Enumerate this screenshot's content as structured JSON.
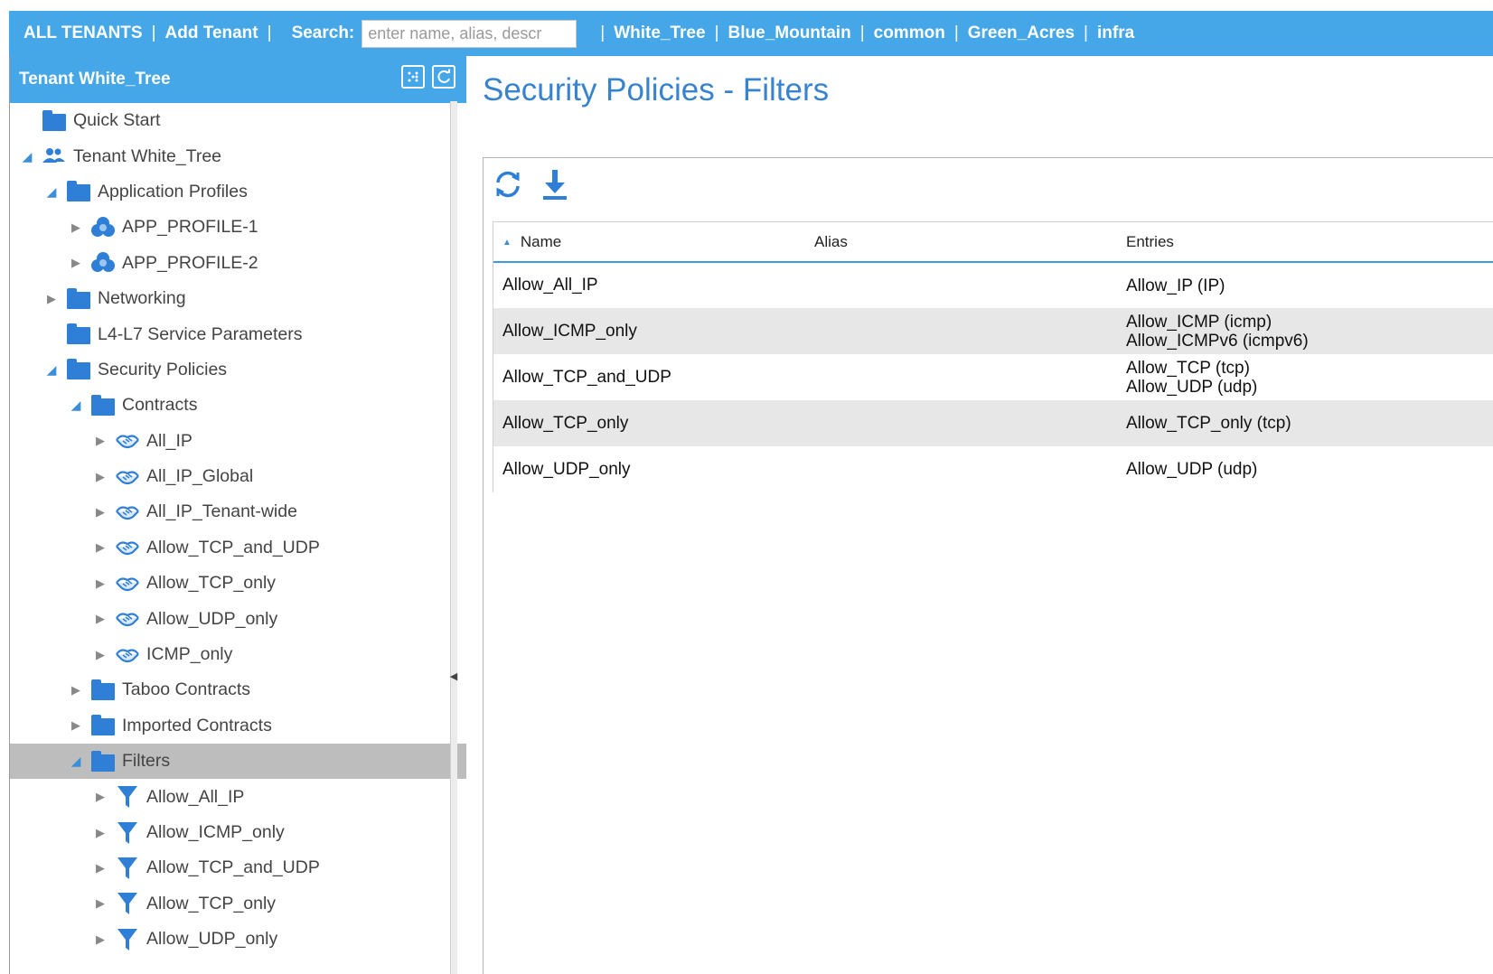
{
  "topbar": {
    "all_tenants": "ALL TENANTS",
    "add_tenant": "Add Tenant",
    "search_label": "Search:",
    "search_placeholder": "enter name, alias, descr",
    "search_value": "",
    "tenants": [
      "White_Tree",
      "Blue_Mountain",
      "common",
      "Green_Acres",
      "infra"
    ],
    "background_color": "#45a7e7"
  },
  "sidebar": {
    "title": "Tenant White_Tree",
    "header_icons": [
      "layout-icon",
      "refresh-icon"
    ],
    "items": [
      {
        "label": "Quick Start",
        "icon": "folder-icon",
        "level": 0,
        "caret": "none"
      },
      {
        "label": "Tenant White_Tree",
        "icon": "tenant-users-icon",
        "level": 0,
        "caret": "expanded"
      },
      {
        "label": "Application Profiles",
        "icon": "folder-icon",
        "level": 1,
        "caret": "expanded"
      },
      {
        "label": "APP_PROFILE-1",
        "icon": "app-profile-icon",
        "level": 2,
        "caret": "collapsed"
      },
      {
        "label": "APP_PROFILE-2",
        "icon": "app-profile-icon",
        "level": 2,
        "caret": "collapsed"
      },
      {
        "label": "Networking",
        "icon": "folder-icon",
        "level": 1,
        "caret": "collapsed"
      },
      {
        "label": "L4-L7 Service Parameters",
        "icon": "folder-icon",
        "level": 1,
        "caret": "none"
      },
      {
        "label": "Security Policies",
        "icon": "folder-icon",
        "level": 1,
        "caret": "expanded"
      },
      {
        "label": "Contracts",
        "icon": "folder-icon",
        "level": 2,
        "caret": "expanded"
      },
      {
        "label": "All_IP",
        "icon": "contract-handshake-icon",
        "level": 3,
        "caret": "collapsed"
      },
      {
        "label": "All_IP_Global",
        "icon": "contract-handshake-icon",
        "level": 3,
        "caret": "collapsed"
      },
      {
        "label": "All_IP_Tenant-wide",
        "icon": "contract-handshake-icon",
        "level": 3,
        "caret": "collapsed"
      },
      {
        "label": "Allow_TCP_and_UDP",
        "icon": "contract-handshake-icon",
        "level": 3,
        "caret": "collapsed"
      },
      {
        "label": "Allow_TCP_only",
        "icon": "contract-handshake-icon",
        "level": 3,
        "caret": "collapsed"
      },
      {
        "label": "Allow_UDP_only",
        "icon": "contract-handshake-icon",
        "level": 3,
        "caret": "collapsed"
      },
      {
        "label": "ICMP_only",
        "icon": "contract-handshake-icon",
        "level": 3,
        "caret": "collapsed"
      },
      {
        "label": "Taboo Contracts",
        "icon": "folder-icon",
        "level": 2,
        "caret": "collapsed"
      },
      {
        "label": "Imported Contracts",
        "icon": "folder-icon",
        "level": 2,
        "caret": "collapsed"
      },
      {
        "label": "Filters",
        "icon": "folder-icon",
        "level": 2,
        "caret": "expanded",
        "selected": true
      },
      {
        "label": "Allow_All_IP",
        "icon": "filter-funnel-icon",
        "level": 3,
        "caret": "collapsed"
      },
      {
        "label": "Allow_ICMP_only",
        "icon": "filter-funnel-icon",
        "level": 3,
        "caret": "collapsed"
      },
      {
        "label": "Allow_TCP_and_UDP",
        "icon": "filter-funnel-icon",
        "level": 3,
        "caret": "collapsed"
      },
      {
        "label": "Allow_TCP_only",
        "icon": "filter-funnel-icon",
        "level": 3,
        "caret": "collapsed"
      },
      {
        "label": "Allow_UDP_only",
        "icon": "filter-funnel-icon",
        "level": 3,
        "caret": "collapsed"
      }
    ]
  },
  "main": {
    "title": "Security Policies - Filters",
    "toolbar_icons": [
      "refresh-icon",
      "download-icon"
    ],
    "table": {
      "columns": [
        "Name",
        "Alias",
        "Entries"
      ],
      "sort_column": "Name",
      "sort_direction": "ascending",
      "rows": [
        {
          "name": "Allow_All_IP",
          "alias": "",
          "entries": [
            "Allow_IP (IP)"
          ]
        },
        {
          "name": "Allow_ICMP_only",
          "alias": "",
          "entries": [
            "Allow_ICMP (icmp)",
            "Allow_ICMPv6 (icmpv6)"
          ]
        },
        {
          "name": "Allow_TCP_and_UDP",
          "alias": "",
          "entries": [
            "Allow_TCP (tcp)",
            "Allow_UDP (udp)"
          ]
        },
        {
          "name": "Allow_TCP_only",
          "alias": "",
          "entries": [
            "Allow_TCP_only (tcp)"
          ]
        },
        {
          "name": "Allow_UDP_only",
          "alias": "",
          "entries": [
            "Allow_UDP (udp)"
          ]
        }
      ]
    }
  },
  "colors": {
    "accent": "#45a7e7",
    "title_blue": "#3783cf",
    "icon_blue": "#2f7fd6",
    "selected_row": "#bdbdbd",
    "alt_row": "#e7e7e7"
  }
}
